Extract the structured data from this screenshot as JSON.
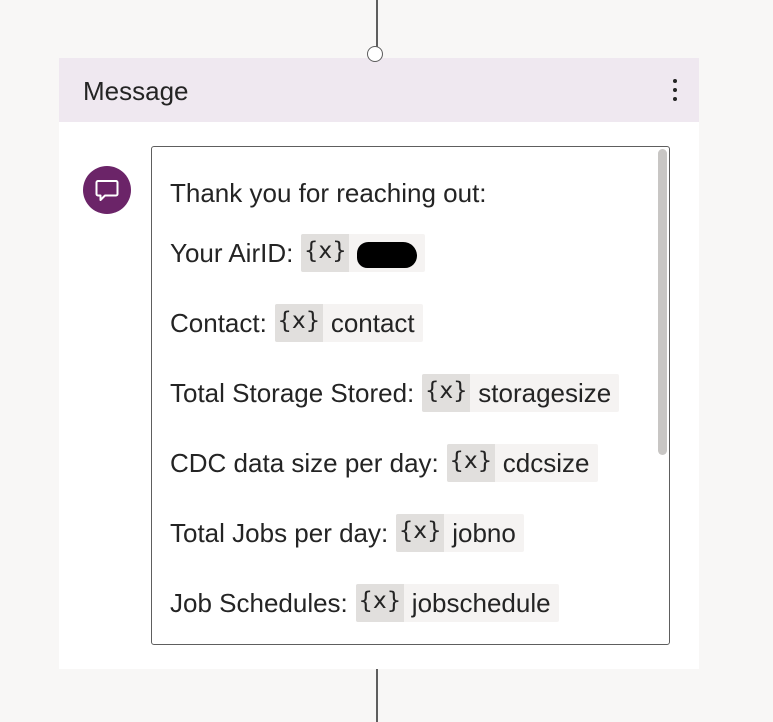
{
  "card": {
    "title": "Message",
    "more_icon": "more-vertical-icon",
    "message_icon": "chat-bubble-icon"
  },
  "message": {
    "intro": "Thank you for reaching out:",
    "variable_icon_label": "{x}",
    "fields": [
      {
        "label": "Your AirID:",
        "variable": "",
        "redacted": true
      },
      {
        "label": "Contact:",
        "variable": "contact"
      },
      {
        "label": "Total Storage Stored:",
        "variable": "storagesize"
      },
      {
        "label": "CDC data size per day:",
        "variable": "cdcsize"
      },
      {
        "label": "Total Jobs per day:",
        "variable": "jobno"
      },
      {
        "label": "Job Schedules:",
        "variable": "jobschedule"
      }
    ]
  },
  "colors": {
    "header_bg": "#efe8f0",
    "icon_accent": "#6b2468",
    "canvas_bg": "#f8f7f6"
  }
}
